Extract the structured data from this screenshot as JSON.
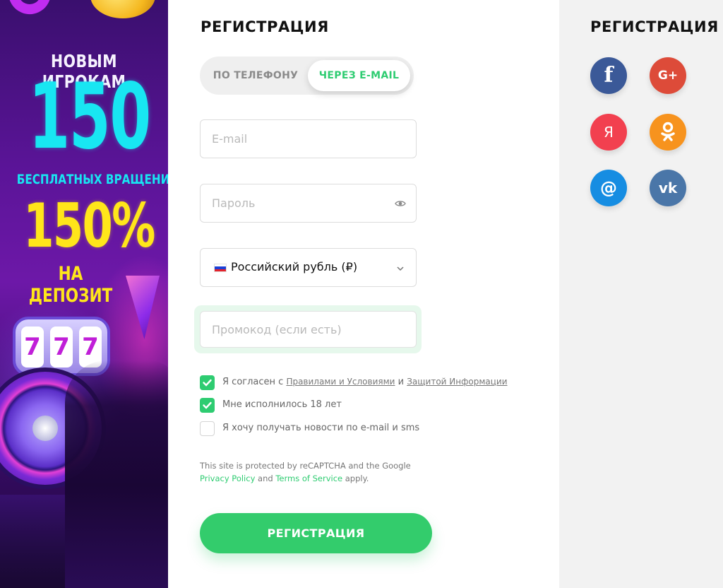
{
  "banner": {
    "line1": "НОВЫМ ИГРОКАМ",
    "big_number": "150",
    "line2": "БЕСПЛАТНЫХ ВРАЩЕНИЙ",
    "big_percent": "150%",
    "line3": "НА ДЕПОЗИТ",
    "slot_symbols": [
      "7",
      "7",
      "7"
    ]
  },
  "form": {
    "title": "РЕГИСТРАЦИЯ",
    "tabs": [
      {
        "label": "ПО ТЕЛЕФОНУ",
        "active": false
      },
      {
        "label": "ЧЕРЕЗ E-MAIL",
        "active": true
      }
    ],
    "email_placeholder": "E-mail",
    "password_placeholder": "Пароль",
    "currency": {
      "value": "Российский рубль (₽)",
      "flag": "ru-flag-icon"
    },
    "promo_placeholder": "Промокод (если есть)",
    "checkboxes": [
      {
        "checked": true,
        "prefix": "Я согласен с",
        "link1": "Правилами и Условиями",
        "joiner": "и",
        "link2": "Защитой Информации"
      },
      {
        "checked": true,
        "text": "Мне исполнилось 18 лет"
      },
      {
        "checked": false,
        "text": "Я хочу получать новости по e-mail и sms"
      }
    ],
    "recaptcha": {
      "line1": "This site is protected by reCAPTCHA and the Google",
      "privacy": "Privacy Policy",
      "and": "and",
      "terms": "Terms of Service",
      "apply": "apply."
    },
    "submit_label": "РЕГИСТРАЦИЯ"
  },
  "social": {
    "title": "РЕГИСТРАЦИЯ",
    "buttons": [
      {
        "icon": "facebook-icon",
        "glyph": "f",
        "color": "#3b5998"
      },
      {
        "icon": "google-plus-icon",
        "glyph": "G+",
        "color": "#dd4b39"
      },
      {
        "icon": "yandex-icon",
        "glyph": "Я",
        "color": "#f2404f"
      },
      {
        "icon": "odnoklassniki-icon",
        "glyph": "ок",
        "color": "#f7931e"
      },
      {
        "icon": "mailru-icon",
        "glyph": "@",
        "color": "#168de2"
      },
      {
        "icon": "vk-icon",
        "glyph": "vk",
        "color": "#4a76a8"
      }
    ]
  },
  "colors": {
    "accent": "#2ecc71",
    "submit": "#33cc6c",
    "social_panel_bg": "#f2f2f2"
  }
}
